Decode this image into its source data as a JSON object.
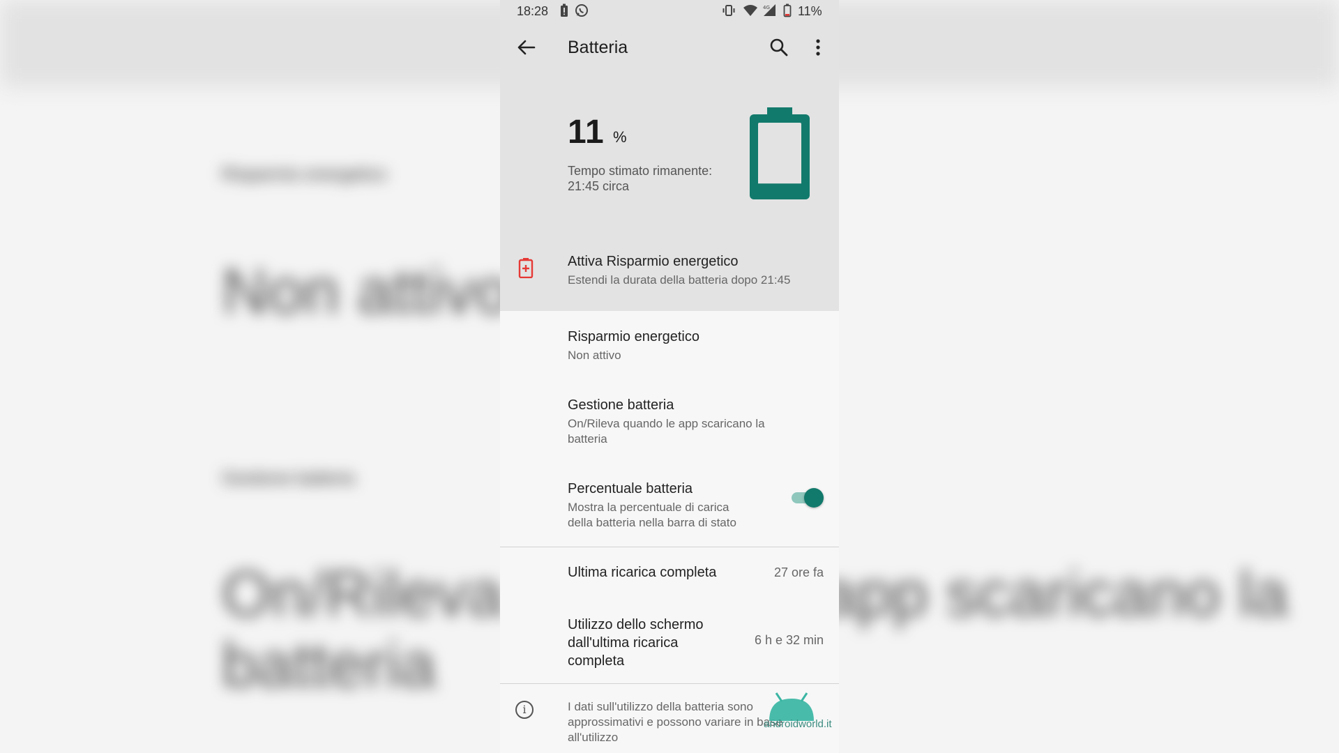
{
  "background_blur": {
    "line1": "Risparmio energetico",
    "line2": "Non attivo",
    "line3": "Gestione batteria",
    "line4": "On/Rileva quando le app scaricano la",
    "line5": "batteria"
  },
  "status_bar": {
    "time": "18:28",
    "battery_text": "11%",
    "network": "4G",
    "icons": [
      "battery-alert-icon",
      "whatsapp-icon",
      "vibrate-icon",
      "wifi-icon",
      "signal-icon",
      "battery-low-icon"
    ]
  },
  "app_bar": {
    "title": "Batteria",
    "back_icon": "arrow-back-icon",
    "search_icon": "search-icon",
    "more_icon": "more-vert-icon"
  },
  "header": {
    "level": "11",
    "unit": "%",
    "estimate_label": "Tempo stimato rimanente:",
    "estimate_value": "21:45 circa",
    "battery_fill_fraction": 0.11,
    "battery_color": "#127a6c"
  },
  "saver_suggestion": {
    "title": "Attiva Risparmio energetico",
    "subtitle": "Estendi la durata della batteria dopo 21:45",
    "icon": "battery-saver-icon",
    "icon_color": "#e53935"
  },
  "settings": {
    "saver": {
      "title": "Risparmio energetico",
      "subtitle": "Non attivo"
    },
    "manager": {
      "title": "Gestione batteria",
      "subtitle_line1": "On/Rileva quando le app scaricano la",
      "subtitle_line2": "batteria"
    },
    "percentage": {
      "title": "Percentuale batteria",
      "subtitle_line1": "Mostra la percentuale di carica",
      "subtitle_line2": "della batteria nella barra di stato",
      "enabled": true,
      "accent": "#127a6c"
    }
  },
  "stats": {
    "last_charge": {
      "title": "Ultima ricarica completa",
      "value": "27 ore fa"
    },
    "screen_usage": {
      "title_line1": "Utilizzo dello schermo",
      "title_line2": "dall'ultima ricarica",
      "title_line3": "completa",
      "value": "6 h e 32 min"
    }
  },
  "footer": {
    "icon": "info-icon",
    "line1": "I dati sull'utilizzo della batteria sono",
    "line2": "approssimativi e possono variare in base",
    "line3": "all'utilizzo"
  },
  "watermark": {
    "text": "androidworld.it",
    "icon": "android-head-icon"
  }
}
